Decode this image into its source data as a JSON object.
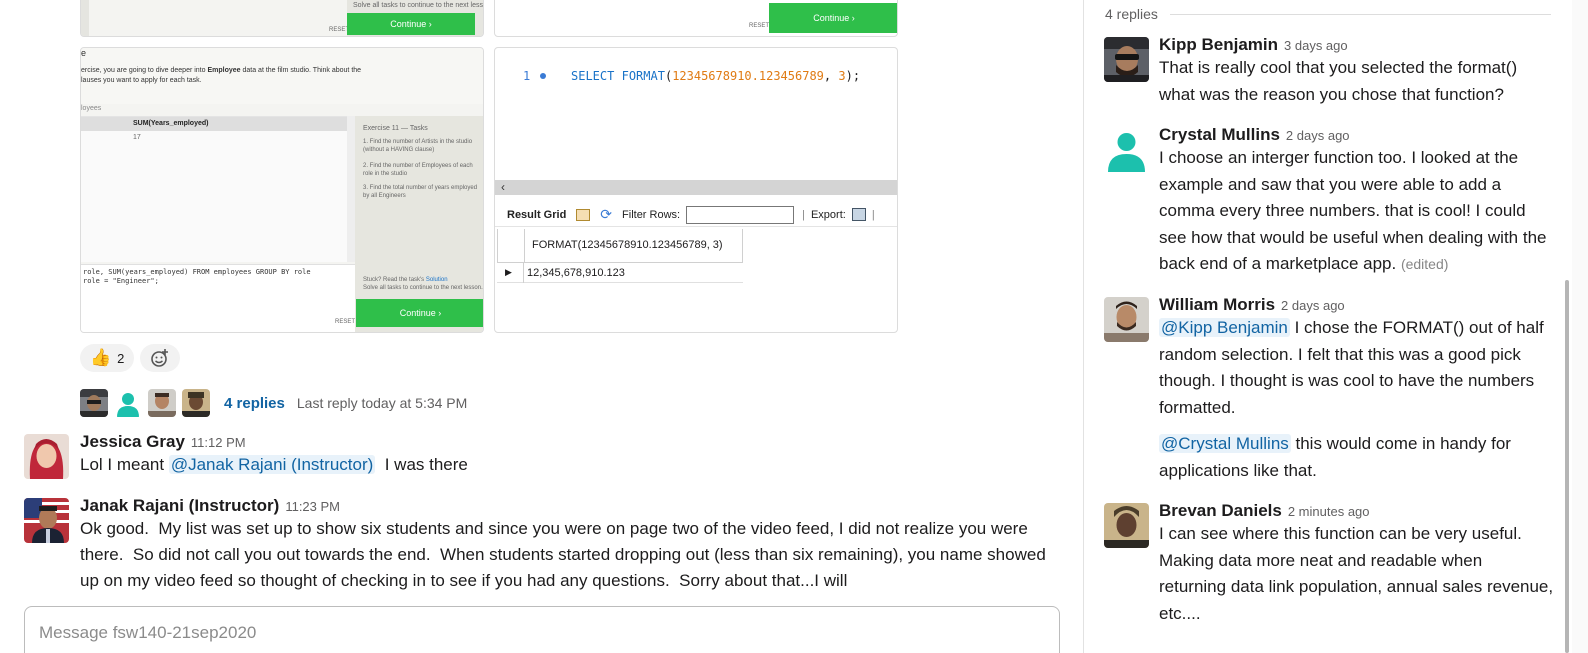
{
  "colors": {
    "link": "#1264a3",
    "green": "#2fbf4a",
    "teal": "#1cc0ad"
  },
  "attachments": {
    "lesson_top": {
      "continue": "Continue ›",
      "note": "Solve all tasks to continue to the next lesson.",
      "reset": "RESET"
    },
    "sql_top": {
      "continue": "Continue ›",
      "reset": "RESET"
    },
    "lesson": {
      "letter": "e",
      "intro_pre": "ercise, you are going to dive deeper into ",
      "intro_bold": "Employee",
      "intro_post": " data at the film studio. Think about the",
      "intro_line2": "lauses you want to apply for each task.",
      "section": "loyees",
      "col_header": "SUM(Years_employed)",
      "col_value": "17",
      "tasks_header": "Exercise 11 — Tasks",
      "task1": "Find the number of Artists in the studio (without a HAVING clause)",
      "task2": "Find the number of Employees of each role in the studio",
      "task3": "Find the total number of years employed by all Engineers",
      "query1": "role, SUM(years_employed) FROM employees GROUP BY role",
      "query2": "role = \"Engineer\";",
      "stuck_pre": "Stuck? Read the task's ",
      "stuck_link": "Solution",
      "stuck_post": "Solve all tasks to continue to the next lesson.",
      "reset": "RESET",
      "continue": "Continue ›"
    },
    "sql": {
      "line_no": "1",
      "query_kw1": "SELECT",
      "query_fn": "FORMAT",
      "query_open": "(",
      "query_num1": "12345678910.123456789",
      "query_comma": ", ",
      "query_num2": "3",
      "query_close": ");",
      "result_grid": "Result Grid",
      "filter_rows": "Filter Rows:",
      "export": "Export:",
      "column_header": "FORMAT(12345678910.123456789, 3)",
      "cell_value": "12,345,678,910.123"
    }
  },
  "reactions": [
    {
      "icon": "thumbs-up-icon",
      "glyph": "👍",
      "count": "2"
    }
  ],
  "thread_summary": {
    "replies": "4 replies",
    "last_reply": "Last reply today at 5:34 PM"
  },
  "messages": [
    {
      "name": "Jessica Gray",
      "time": "11:12 PM",
      "pre": "Lol I meant ",
      "mention": "@Janak Rajani (Instructor)",
      "post": "  I was there"
    },
    {
      "name": "Janak Rajani (Instructor)",
      "time": "11:23 PM",
      "text": "Ok good.  My list was set up to show six students and since you were on page two of the video feed, I did not realize you were there.  So did not call you out towards the end.  When students started dropping out (less than six remaining), you name showed up on my video feed so thought of checking in to see if you had any questions.  Sorry about that...I will"
    }
  ],
  "composer": {
    "placeholder": "Message fsw140-21sep2020"
  },
  "thread": {
    "count": "4 replies",
    "replies": [
      {
        "name": "Kipp Benjamin",
        "time": "3 days ago",
        "text": "That is really cool that you selected the format() what was the reason you chose that function?"
      },
      {
        "name": "Crystal Mullins",
        "time": "2 days ago",
        "text": "I choose an interger function too. I looked at the example and saw that you were able to add a comma every three numbers. that is cool! I could see how that would be useful when dealing with the back end of a marketplace app.",
        "edited": "(edited)"
      },
      {
        "name": "William Morris",
        "time": "2 days ago",
        "mention1": "@Kipp Benjamin",
        "text1": " I chose the FORMAT() out of half random selection. I felt that this was a good pick though. I thought is was cool to have the numbers formatted.",
        "mention2": "@Crystal Mullins",
        "text2": " this would come in handy for applications like that."
      },
      {
        "name": "Brevan Daniels",
        "time": "2 minutes ago",
        "text": "I can see where this function can be very useful. Making data more neat and readable when returning data link population, annual sales revenue, etc...."
      }
    ]
  }
}
